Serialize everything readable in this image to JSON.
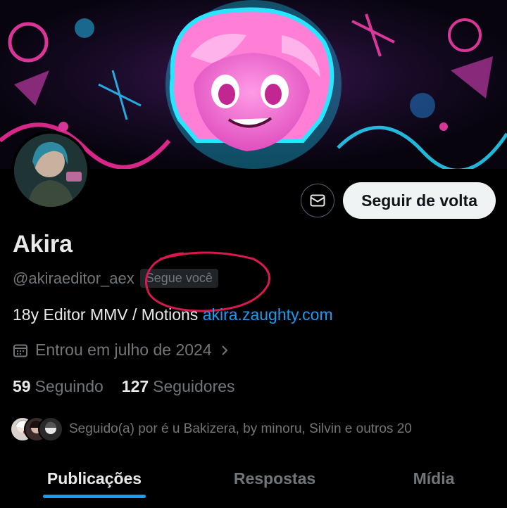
{
  "profile": {
    "name": "Akira",
    "handle": "@akiraeditor_aex",
    "follows_you": "Segue você",
    "bio_text": "18y Editor MMV / Motions ",
    "bio_link": "akira.zaughty.com",
    "joined": "Entrou em julho de 2024",
    "following_count": "59",
    "following_label": "Seguindo",
    "followers_count": "127",
    "followers_label": "Seguidores",
    "followed_by": "Seguido(a) por é u Bakizera, by minoru, Silvin e outros 20"
  },
  "actions": {
    "message_icon": "mail-icon",
    "follow_back": "Seguir de volta"
  },
  "tabs": [
    {
      "label": "Publicações",
      "active": true
    },
    {
      "label": "Respostas",
      "active": false
    },
    {
      "label": "Mídia",
      "active": false
    }
  ],
  "colors": {
    "accent": "#1d9bf0",
    "annotation": "#d8194d",
    "banner_pink": "#ff4fd8",
    "banner_cyan": "#28e6ff"
  }
}
